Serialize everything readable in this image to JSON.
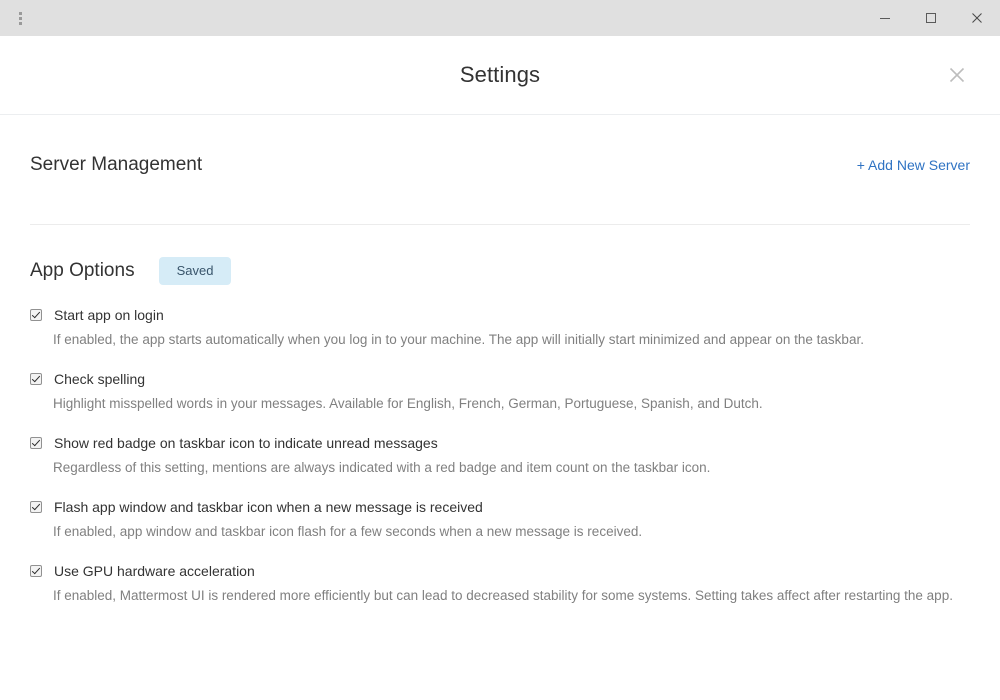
{
  "titlebar": {
    "menu_icon": "kebab-menu-icon",
    "minimize_label": "Minimize",
    "maximize_label": "Maximize",
    "close_label": "Close",
    "background_color": "#e0e0e0"
  },
  "modal": {
    "title": "Settings",
    "close_label": "Close settings"
  },
  "server_section": {
    "title": "Server Management",
    "add_link": "+ Add New Server",
    "link_color": "#2f73c3"
  },
  "app_options": {
    "title": "App Options",
    "saved_badge": "Saved",
    "badge_bg": "#d6ecf7",
    "badge_color": "#39556b",
    "options": [
      {
        "label": "Start app on login",
        "description": "If enabled, the app starts automatically when you log in to your machine. The app will initially start minimized and appear on the taskbar.",
        "checked": true
      },
      {
        "label": "Check spelling",
        "description": "Highlight misspelled words in your messages. Available for English, French, German, Portuguese, Spanish, and Dutch.",
        "checked": true
      },
      {
        "label": "Show red badge on taskbar icon to indicate unread messages",
        "description": "Regardless of this setting, mentions are always indicated with a red badge and item count on the taskbar icon.",
        "checked": true
      },
      {
        "label": "Flash app window and taskbar icon when a new message is received",
        "description": "If enabled, app window and taskbar icon flash for a few seconds when a new message is received.",
        "checked": true
      },
      {
        "label": "Use GPU hardware acceleration",
        "description": "If enabled, Mattermost UI is rendered more efficiently but can lead to decreased stability for some systems. Setting takes affect after restarting the app.",
        "checked": true
      }
    ]
  }
}
